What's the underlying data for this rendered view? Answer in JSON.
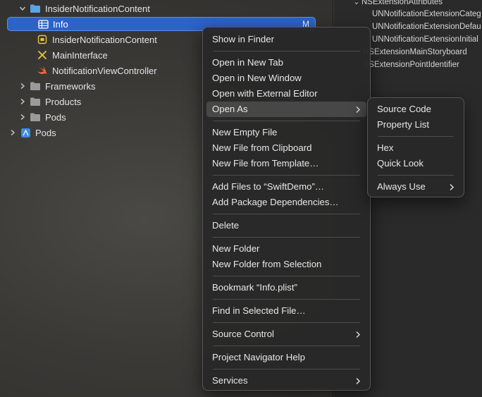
{
  "navigator": {
    "items": [
      {
        "label": "InsiderNotificationContent",
        "icon": "folder-icon"
      },
      {
        "label": "Info",
        "icon": "plist-table-icon",
        "badge": "M"
      },
      {
        "label": "InsiderNotificationContent",
        "icon": "entitlements-icon"
      },
      {
        "label": "MainInterface",
        "icon": "storyboard-icon"
      },
      {
        "label": "NotificationViewController",
        "icon": "swift-icon"
      },
      {
        "label": "Frameworks",
        "icon": "folder-icon"
      },
      {
        "label": "Products",
        "icon": "folder-icon"
      },
      {
        "label": "Pods",
        "icon": "folder-icon"
      },
      {
        "label": "Pods",
        "icon": "project-icon"
      }
    ]
  },
  "inspector": {
    "rows": [
      "NSExtensionAttributes",
      "UNNotificationExtensionCateg",
      "UNNotificationExtensionDefau",
      "UNNotificationExtensionInitial",
      "NSExtensionMainStoryboard",
      "NSExtensionPointIdentifier"
    ]
  },
  "context_menu": {
    "items": [
      "Show in Finder",
      "Open in New Tab",
      "Open in New Window",
      "Open with External Editor",
      "Open As",
      "New Empty File",
      "New File from Clipboard",
      "New File from Template…",
      "Add Files to “SwiftDemo”…",
      "Add Package Dependencies…",
      "Delete",
      "New Folder",
      "New Folder from Selection",
      "Bookmark “Info.plist”",
      "Find in Selected File…",
      "Source Control",
      "Project Navigator Help",
      "Services"
    ]
  },
  "submenu": {
    "items": [
      "Source Code",
      "Property List",
      "Hex",
      "Quick Look",
      "Always Use"
    ]
  },
  "colors": {
    "selection": "#2c63c7",
    "folder": "#5aa3e6",
    "storyboard": "#e8c547",
    "swift": "#f0683a",
    "entitlements": "#e8c547",
    "project": "#3d8de0"
  }
}
